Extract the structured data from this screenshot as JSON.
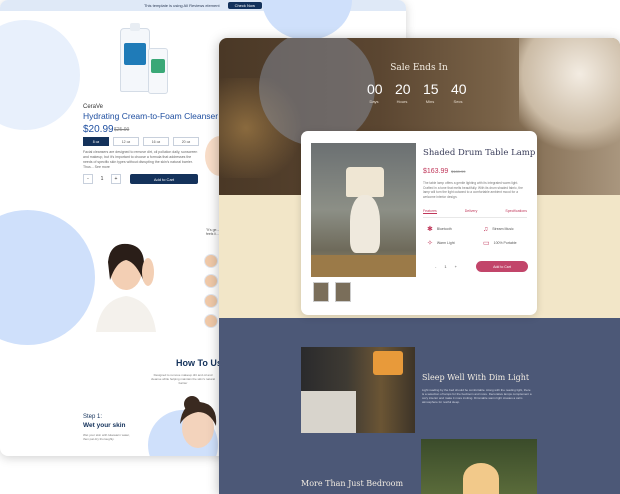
{
  "back": {
    "topbar": {
      "text": "This template is using All Reviews element",
      "button": "Check Now"
    },
    "brand": "CeraVe",
    "title": "Hydrating Cream-to-Foam Cleanser",
    "price": "$20.99",
    "old_price": "$25.99",
    "sizes": [
      "8 oz",
      "12 oz",
      "16 oz",
      "20 oz"
    ],
    "description": "Facial cleansers are designed to remove dirt, oil pollution daily, sunscreen and makeup, but it's important to choose a formula that addresses the needs of specific skin types without disrupting the skin's natural barrier. Thus... See more",
    "qty_minus": "-",
    "qty_value": "1",
    "qty_plus": "+",
    "add_to_cart": "Add to Cart",
    "side_text": "\"It's ge... feels li...",
    "how_to_title": "How To Us",
    "how_to_sub": "Designed to remove makeup dirt and oil and cleanse while helping maintain the skin's natural barrier",
    "step_label": "Step 1:",
    "step_title": "Wet your skin",
    "step_desc": "Wet your skin with lukewarm water, then pat dry thoroughly."
  },
  "front": {
    "sale_title": "Sale Ends In",
    "countdown": [
      {
        "value": "00",
        "label": "Days"
      },
      {
        "value": "20",
        "label": "Hours"
      },
      {
        "value": "15",
        "label": "Mins"
      },
      {
        "value": "40",
        "label": "Secs"
      }
    ],
    "product": {
      "title": "Shaded Drum Table Lamp",
      "price": "$163.99",
      "old_price": "$189.99",
      "description": "The table lamp offers a gentle lighting with its integrated warm light. Crafted in a tone that melts beautifully. With its drum shaded fabric, the lamp will turn the light outward to a comfortable ambient mood for a welcome interior design.",
      "tabs": [
        "Features",
        "Delivery",
        "Specifications"
      ],
      "features": [
        {
          "icon": "bluetooth-icon",
          "glyph": "✱",
          "label": "Bluetooth"
        },
        {
          "icon": "music-icon",
          "glyph": "♫",
          "label": "Stream Music"
        },
        {
          "icon": "light-icon",
          "glyph": "💡",
          "label": "Warm Light"
        },
        {
          "icon": "battery-icon",
          "glyph": "▭",
          "label": "100% Portable"
        }
      ],
      "qty_minus": "-",
      "qty_value": "1",
      "qty_plus": "+",
      "add_to_cart": "Add to Cart"
    },
    "section2_title": "Sleep Well With Dim Light",
    "section2_desc": "Light reading by the bed should be comfortable. Along with the reading light, there is a selection of lamps for the bedroom and more. Decorative lamps complement a cozy interior and make it more inviting. Dimmable warm light creates a calm atmosphere for restful sleep.",
    "section3_title": "More Than Just Bedroom"
  }
}
